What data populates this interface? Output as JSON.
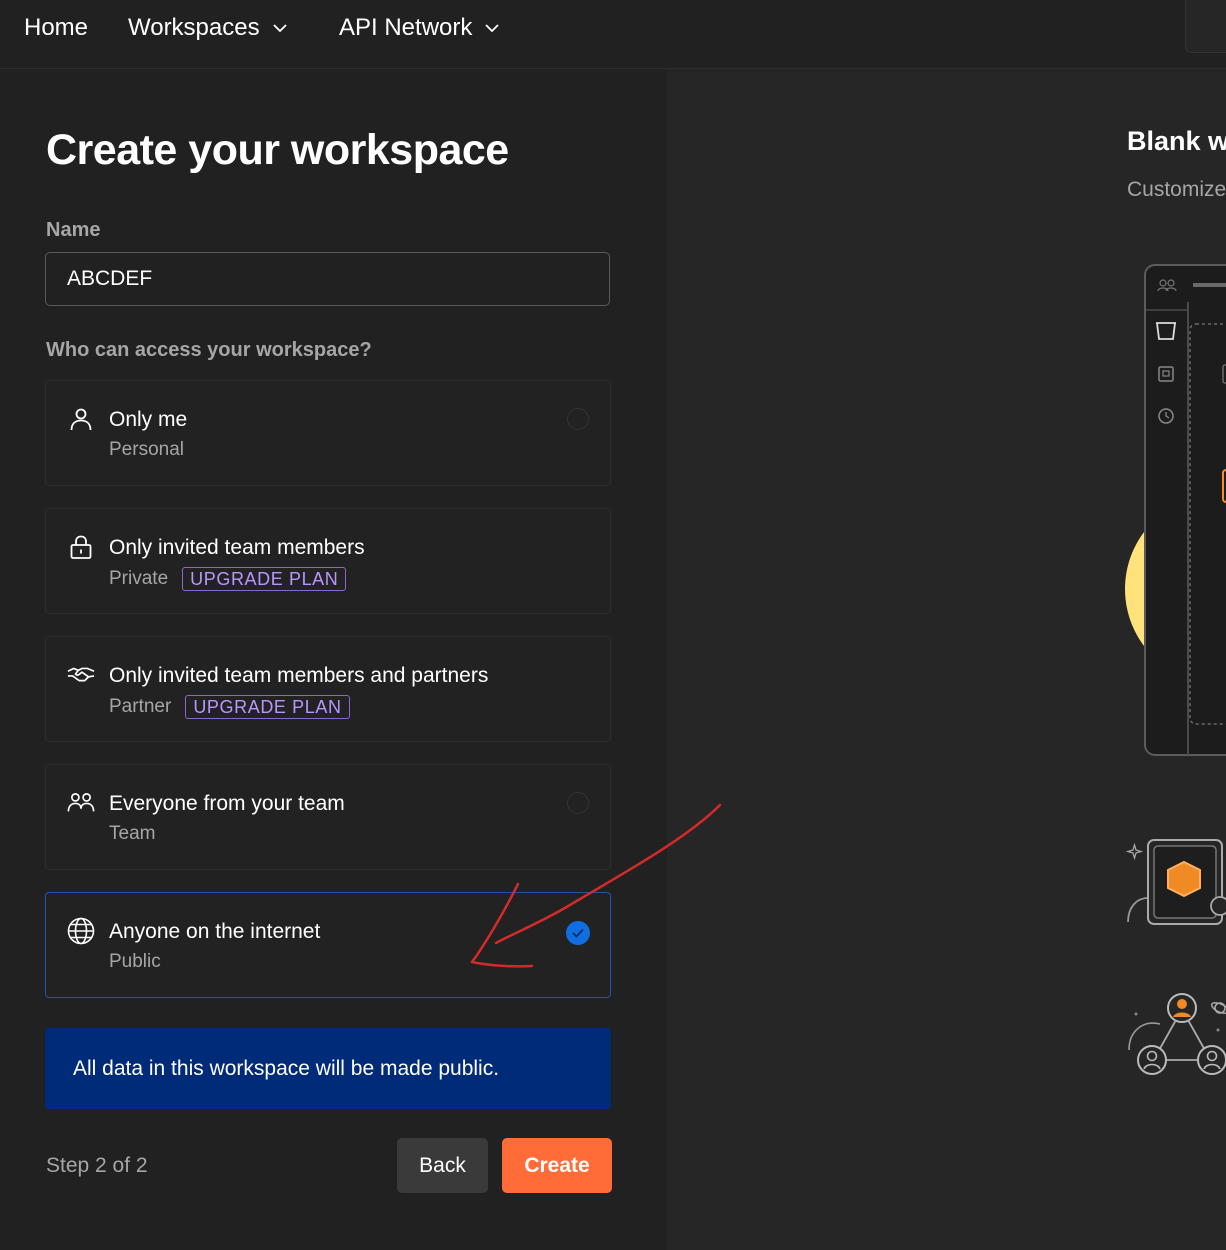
{
  "nav": {
    "items": [
      {
        "label": "Home"
      },
      {
        "label": "Workspaces"
      },
      {
        "label": "API Network"
      }
    ]
  },
  "form": {
    "title": "Create your workspace",
    "name_label": "Name",
    "name_value": "ABCDEF",
    "access_label": "Who can access your workspace?",
    "options": [
      {
        "title": "Only me",
        "subtitle": "Personal",
        "icon": "person-icon",
        "selected": false
      },
      {
        "title": "Only invited team members",
        "subtitle": "Private",
        "badge": "UPGRADE PLAN",
        "icon": "lock-icon",
        "selected": false
      },
      {
        "title": "Only invited team members and partners",
        "subtitle": "Partner",
        "badge": "UPGRADE PLAN",
        "icon": "handshake-icon",
        "selected": false
      },
      {
        "title": "Everyone from your team",
        "subtitle": "Team",
        "icon": "team-icon",
        "selected": false
      },
      {
        "title": "Anyone on the internet",
        "subtitle": "Public",
        "icon": "globe-icon",
        "selected": true
      }
    ],
    "notice": "All data in this workspace will be made public.",
    "step": "Step 2 of 2",
    "back_label": "Back",
    "create_label": "Create"
  },
  "preview": {
    "title": "Blank w",
    "subtitle": "Customize"
  },
  "colors": {
    "accent": "#ff6c37",
    "selected_border": "#1a55b0",
    "notice_bg": "#002b78",
    "badge": "#b996ff",
    "annotation": "#d42a2a"
  }
}
